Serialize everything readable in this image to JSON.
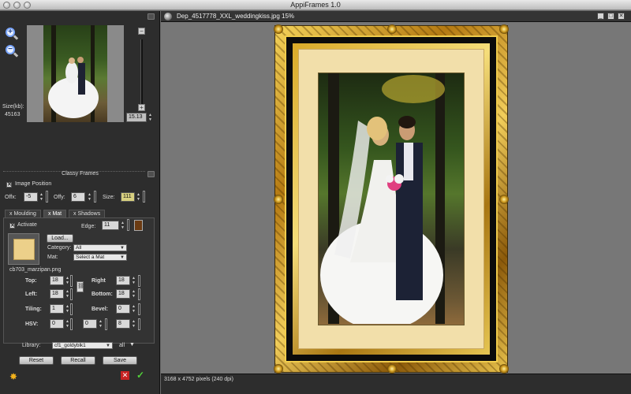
{
  "window": {
    "title": "AppiFrames 1.0"
  },
  "preview": {
    "size_label": "Size(kb):",
    "size_value": "45163",
    "zoom_value": "15.13"
  },
  "classy_frames": {
    "title": "Classy Frames",
    "image_position_label": "Image Position",
    "offx_label": "Offx:",
    "offx_value": "-5",
    "offy_label": "Offy:",
    "offy_value": "6",
    "size_label": "Size:",
    "size_value": "111"
  },
  "tabs": [
    {
      "label": "x Moulding"
    },
    {
      "label": "x Mat"
    },
    {
      "label": "x Shadows"
    }
  ],
  "mat": {
    "activate_label": "Activate",
    "edge_label": "Edge:",
    "edge_value": "11",
    "load_button": "Load...",
    "category_label": "Category:",
    "category_value": "All",
    "mat_label": "Mat:",
    "mat_value": "Select a Mat",
    "filename": "cb703_marzipan.png",
    "swatch_color": "#ecd08a",
    "edge_color": "#6b3b12",
    "top_label": "Top:",
    "top_value": "18",
    "right_label": "Right",
    "right_value": "18",
    "left_label": "Left:",
    "left_value": "18",
    "bottom_label": "Bottom:",
    "bottom_value": "18",
    "tiling_label": "Tiling:",
    "tiling_value": "1",
    "bevel_label": "Bevel:",
    "bevel_value": "0",
    "hsv_label": "HSV:",
    "hsv_h": "0",
    "hsv_s": "0",
    "hsv_v": "8"
  },
  "library": {
    "label": "Library:",
    "value": "cf1_goldyblk1",
    "filter_value": "all"
  },
  "actions": {
    "reset": "Reset",
    "recall": "Recall",
    "save": "Save"
  },
  "document": {
    "title": "Dep_4517778_XXL_weddingkiss.jpg 15%",
    "status": "3168 x 4752 pixels (240 dpi)"
  }
}
